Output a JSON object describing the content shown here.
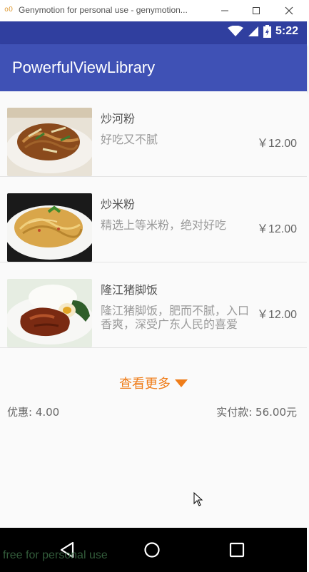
{
  "window": {
    "title": "Genymotion for personal use - genymotion...",
    "app_icon": "oO"
  },
  "status_bar": {
    "time": "5:22",
    "icons": [
      "wifi-icon",
      "signal-icon",
      "battery-icon"
    ]
  },
  "app_bar": {
    "title": "PowerfulViewLibrary"
  },
  "items": [
    {
      "name": "炒河粉",
      "desc": "好吃又不腻",
      "price": "￥12.00",
      "image": "fried-noodles-photo"
    },
    {
      "name": "炒米粉",
      "desc": "精选上等米粉，绝对好吃",
      "price": "￥12.00",
      "image": "fried-rice-noodles-photo"
    },
    {
      "name": "隆江猪脚饭",
      "desc": "隆江猪脚饭，肥而不腻，入口香爽，深受广东人民的喜爱",
      "price": "￥12.00",
      "image": "pork-knuckle-rice-photo"
    }
  ],
  "more": {
    "label": "查看更多"
  },
  "summary": {
    "discount": "优惠: 4.00",
    "paid": "实付款: 56.00元"
  },
  "watermark": "free for personal use",
  "colors": {
    "status_bar": "#303f9f",
    "app_bar": "#3f51b5",
    "accent": "#ef7d1a"
  }
}
